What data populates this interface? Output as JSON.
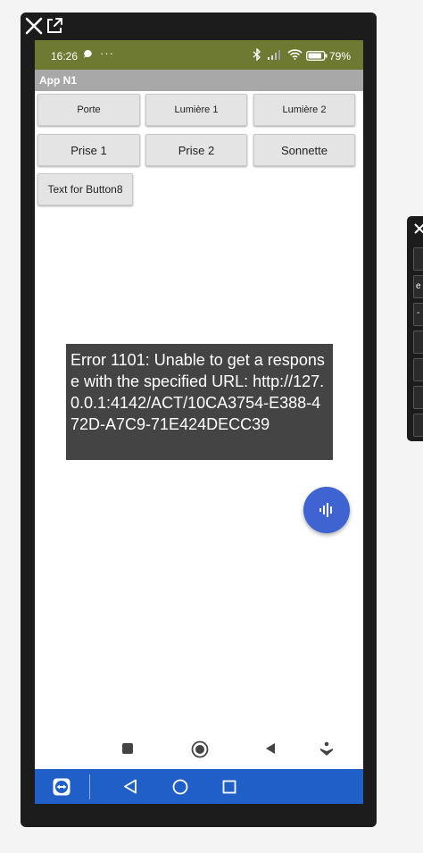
{
  "status_bar": {
    "time": "16:26",
    "more": "···",
    "battery_percent": "79%"
  },
  "app_bar": {
    "title": "App N1"
  },
  "buttons": {
    "row1": [
      "Porte",
      "Lumière 1",
      "Lumière 2"
    ],
    "row2": [
      "Prise 1",
      "Prise 2",
      "Sonnette"
    ],
    "row3": [
      "Text for Button8"
    ]
  },
  "error_message": "Error 1101: Unable to get a response with the specified URL: http://127.0.0.1:4142/ACT/10CA3754-E388-472D-A7C9-71E424DECC39",
  "side_panel": {
    "cut_letters": [
      "e",
      "-"
    ]
  },
  "icons": {
    "window": [
      "close-icon",
      "open-external-icon"
    ],
    "status": [
      "message-icon",
      "bluetooth-icon",
      "signal-icon",
      "wifi-icon",
      "battery-icon"
    ],
    "fab": "voice-wave-icon",
    "system_keys": [
      "square-key-icon",
      "home-circle-icon",
      "back-triangle-icon",
      "nav-hand-icon"
    ],
    "bottom_nav": [
      "teamviewer-icon",
      "back-icon",
      "home-icon",
      "recents-icon"
    ]
  },
  "colors": {
    "status_bar": "#6e7a32",
    "title_bar": "#a8a8a8",
    "fab": "#3f64d2",
    "bottom_bar": "#1f5fc7",
    "error_toast": "#444444"
  }
}
